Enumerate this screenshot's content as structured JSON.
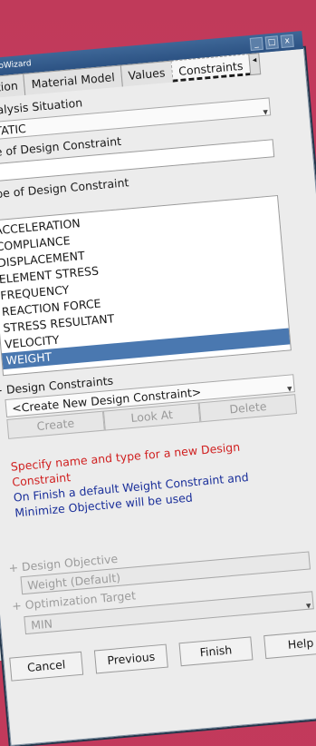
{
  "window": {
    "title": "TopoWizard",
    "controls": [
      "_",
      "□",
      "x"
    ]
  },
  "tabs": [
    "Direction",
    "Material Model",
    "Values",
    "Constraints"
  ],
  "tab_arrow": "◂",
  "analysis": {
    "label": "Analysis Situation",
    "toggle": "+",
    "value": "STATIC"
  },
  "name_label": "Name of Design Constraint",
  "type_section": {
    "toggle": "-",
    "label": "Type of Design Constraint",
    "items": [
      "ACCELERATION",
      "COMPLIANCE",
      "DISPLACEMENT",
      "ELEMENT STRESS",
      "FREQUENCY",
      "REACTION FORCE",
      "STRESS RESULTANT",
      "VELOCITY",
      "WEIGHT"
    ],
    "selected": "WEIGHT"
  },
  "design_constraints": {
    "toggle": "+",
    "label": "Design Constraints",
    "value": "<Create New Design Constraint>"
  },
  "action_buttons": {
    "create": "Create",
    "look_at": "Look At",
    "delete": "Delete"
  },
  "message": {
    "red": "Specify name and type for a new Design Constraint",
    "blue": "On Finish a default Weight Constraint and Minimize Objective will be used"
  },
  "design_objective": {
    "toggle": "+",
    "label": "Design Objective",
    "value": "Weight (Default)"
  },
  "optimization_target": {
    "toggle": "+",
    "label": "Optimization Target",
    "value": "MIN"
  },
  "footer": {
    "cancel": "Cancel",
    "previous": "Previous",
    "finish": "Finish",
    "help": "Help"
  },
  "colors": {
    "selection": "#4a78b0",
    "warning": "#d02020",
    "info": "#1a2f9a",
    "background_top": "#c03a5a"
  }
}
